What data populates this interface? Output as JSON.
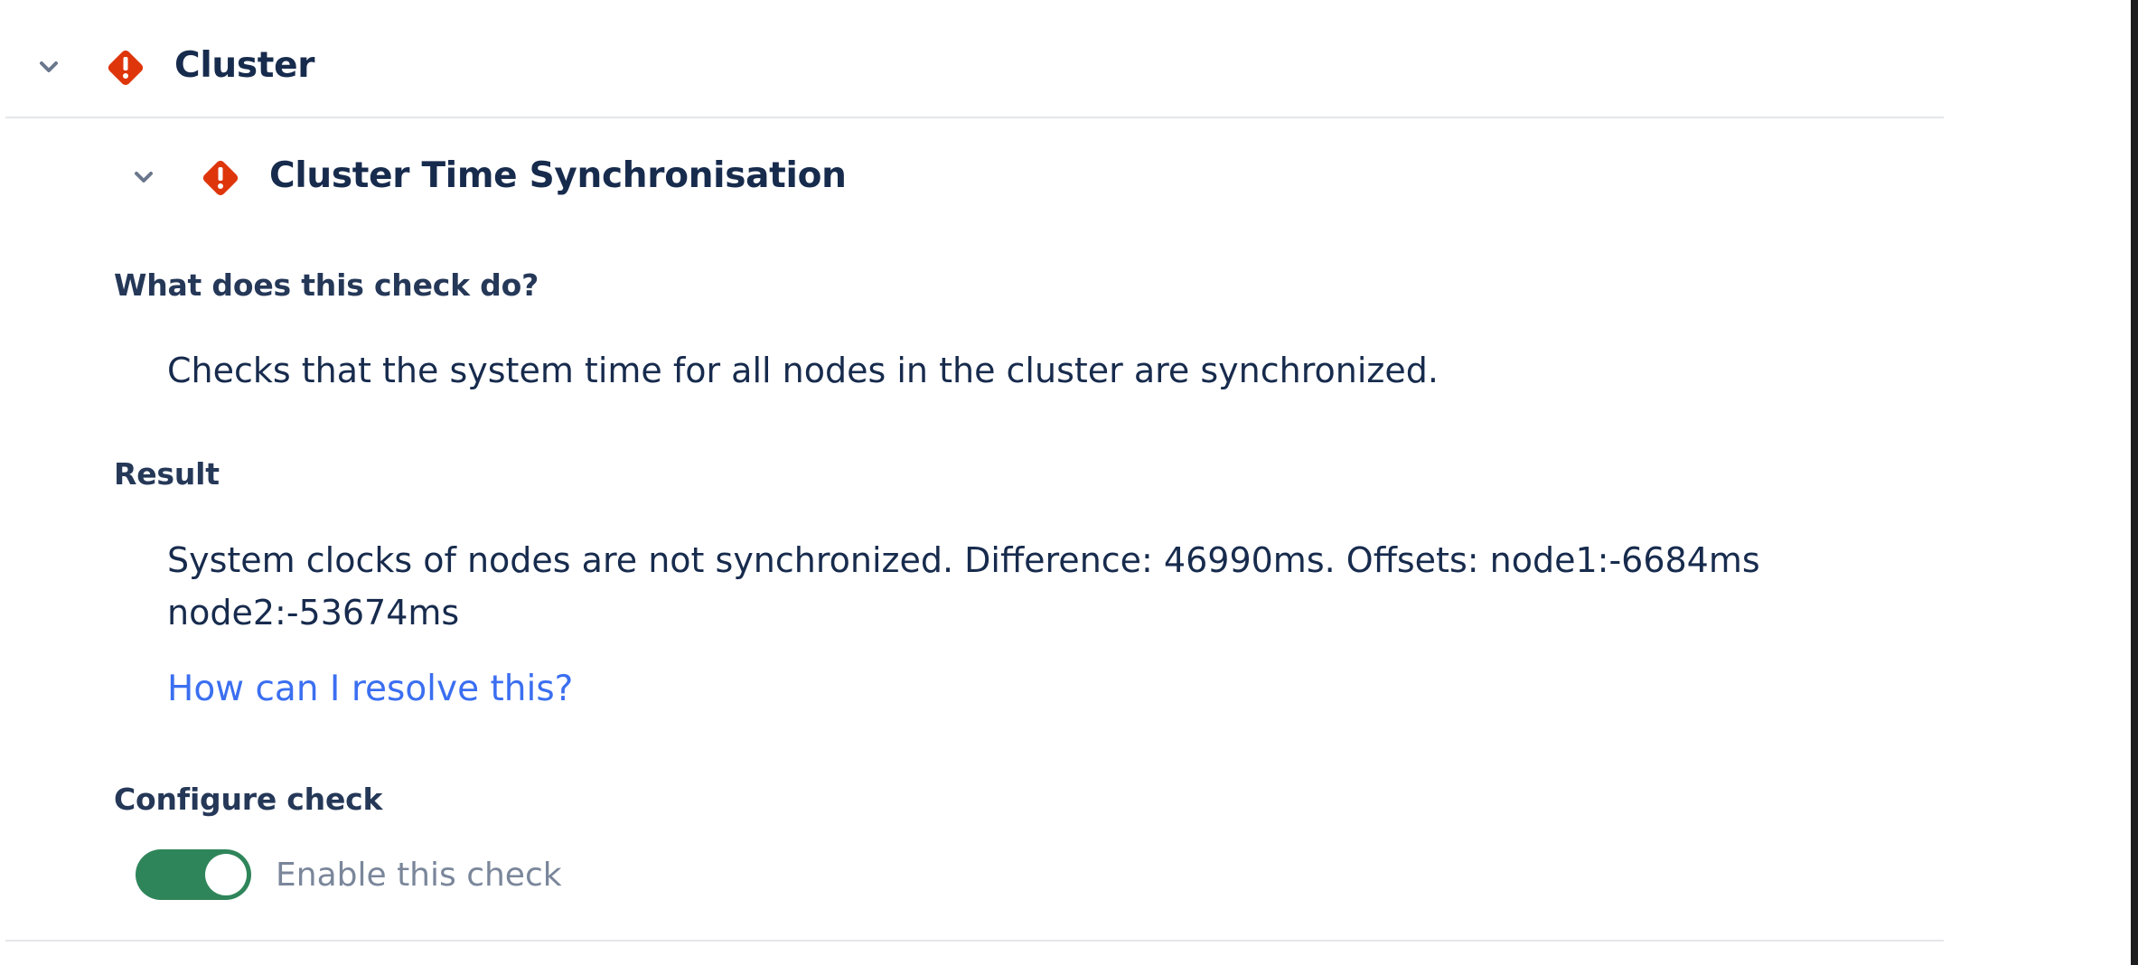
{
  "cluster_section": {
    "title": "Cluster",
    "status": "error",
    "expanded": true
  },
  "check": {
    "title": "Cluster Time Synchronisation",
    "status": "error",
    "expanded": true,
    "what_label": "What does this check do?",
    "description": "Checks that the system time for all nodes in the cluster are synchronized.",
    "result_label": "Result",
    "result_line1": "System clocks of nodes are not synchronized. Difference: 46990ms. Offsets: node1:-6684ms",
    "result_line2": "node2:-53674ms",
    "resolve_link": "How can I resolve this?",
    "configure_label": "Configure check",
    "enable_label": "Enable this check",
    "enabled": true
  },
  "colors": {
    "error_icon": "#de350b",
    "toggle_on": "#2f855a",
    "link": "#3b6ff1",
    "heading": "#172b4d"
  },
  "icons": {
    "chevron": "chevron-down-icon",
    "status": "error-diamond-icon"
  }
}
